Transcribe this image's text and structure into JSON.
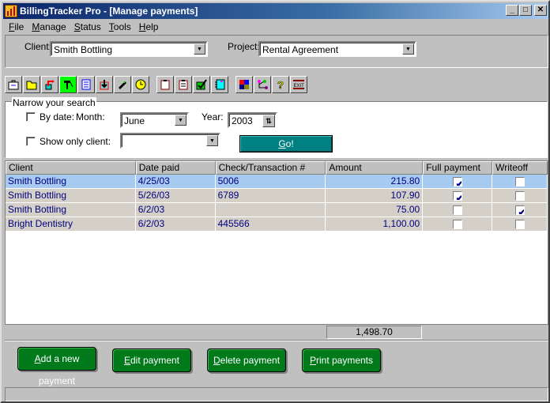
{
  "window": {
    "title": "BillingTracker Pro - [Manage payments]",
    "controls": [
      "minimize",
      "maximize",
      "close"
    ]
  },
  "menu": [
    {
      "label": "File",
      "key": "F",
      "rest": "ile"
    },
    {
      "label": "Manage",
      "key": "M",
      "rest": "anage"
    },
    {
      "label": "Status",
      "key": "S",
      "rest": "tatus"
    },
    {
      "label": "Tools",
      "key": "T",
      "rest": "ools"
    },
    {
      "label": "Help",
      "key": "H",
      "rest": "elp"
    }
  ],
  "selectors": {
    "client_label": "Client:",
    "client_value": "Smith Bottling",
    "project_label": "Project:",
    "project_value": "Rental Agreement"
  },
  "toolbar": {
    "icons": [
      "briefcase-icon",
      "folder-icon",
      "export-icon",
      "hammer-icon",
      "document-icon",
      "import-box-icon",
      "phone-icon",
      "clock-icon",
      "clipboard-icon",
      "clipboard-list-icon",
      "checkbox-box-icon",
      "notebook-icon",
      "color-grid-icon",
      "network-icon",
      "help-icon",
      "exit-icon"
    ],
    "exit_label": "EXIT"
  },
  "search": {
    "legend": "Narrow your search",
    "by_date_label": "By date:",
    "by_date_checked": false,
    "month_label": "Month:",
    "month_value": "June",
    "year_label": "Year:",
    "year_value": "2003",
    "show_client_label": "Show only client:",
    "show_client_checked": false,
    "client_value": "",
    "go_key": "G",
    "go_rest": "o!"
  },
  "grid": {
    "headers": [
      "Client",
      "Date paid",
      "Check/Transaction #",
      "Amount",
      "Full payment",
      "Writeoff"
    ],
    "rows": [
      {
        "client": "Smith Bottling",
        "date": "4/25/03",
        "check": "5006",
        "amount": "215.80",
        "full": true,
        "writeoff": false,
        "selected": true
      },
      {
        "client": "Smith Bottling",
        "date": "5/26/03",
        "check": "6789",
        "amount": "107.90",
        "full": true,
        "writeoff": false,
        "selected": false
      },
      {
        "client": "Smith Bottling",
        "date": "6/2/03",
        "check": "",
        "amount": "75.00",
        "full": false,
        "writeoff": true,
        "selected": false
      },
      {
        "client": "Bright Dentistry",
        "date": "6/2/03",
        "check": "445566",
        "amount": "1,100.00",
        "full": false,
        "writeoff": false,
        "selected": false
      }
    ],
    "total": "1,498.70"
  },
  "buttons": [
    {
      "key": "A",
      "rest": "dd a new payment"
    },
    {
      "key": "E",
      "rest": "dit payment"
    },
    {
      "key": "D",
      "rest": "elete payment"
    },
    {
      "key": "P",
      "rest": "rint payments"
    }
  ],
  "colors": {
    "title_start": "#0a246a",
    "selected_row": "#a6caf0",
    "row_bg": "#d4d0c8",
    "go_button": "#008080",
    "action_button": "#007a1a",
    "grid_text": "#000080"
  }
}
